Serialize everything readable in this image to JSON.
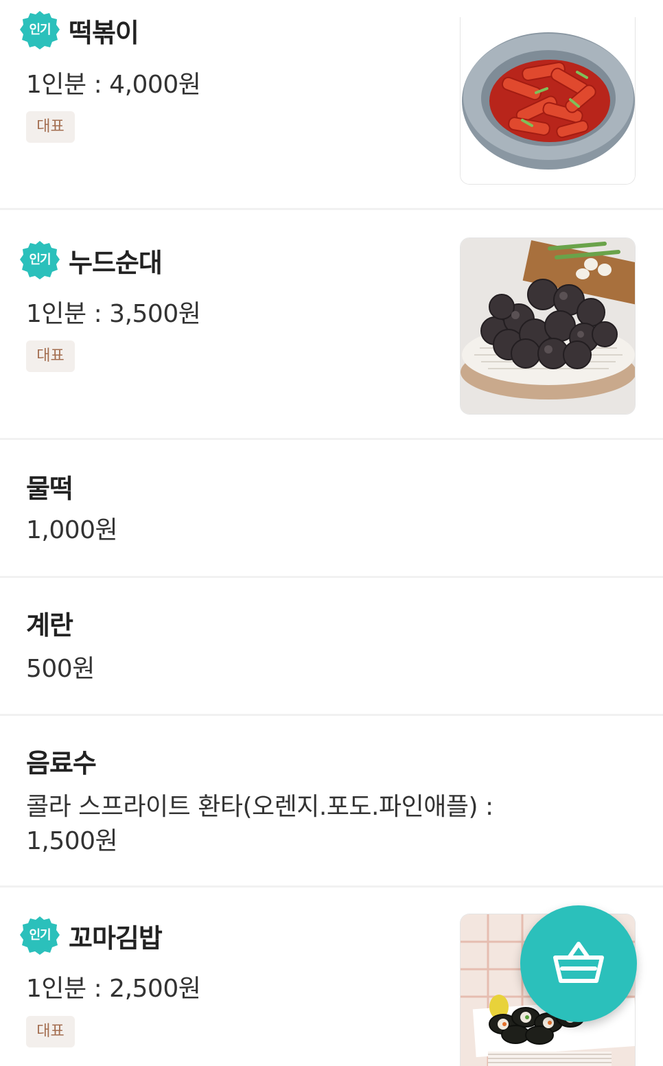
{
  "menu": {
    "items": [
      {
        "name": "떡볶이",
        "badge": "인기",
        "price": "1인분 : 4,000원",
        "tag": "대표",
        "image": "tteokbokki-photo"
      },
      {
        "name": "누드순대",
        "badge": "인기",
        "price": "1인분 : 3,500원",
        "tag": "대표",
        "image": "sundae-photo"
      },
      {
        "name": "물떡",
        "price": "1,000원"
      },
      {
        "name": "계란",
        "price": "500원"
      },
      {
        "name": "음료수",
        "price_line1": "콜라 스프라이트 환타(오렌지.포도.파인애플) :",
        "price_line2": "1,500원"
      },
      {
        "name": "꼬마김밥",
        "badge": "인기",
        "price": "1인분 : 2,500원",
        "tag": "대표",
        "image": "kimbap-photo"
      }
    ]
  },
  "cart_button": {
    "icon": "shopping-basket-icon"
  },
  "colors": {
    "accent": "#2bc0bb",
    "tag_bg": "#f3efec",
    "tag_text": "#a36d4f",
    "divider": "#f1f1f1"
  }
}
